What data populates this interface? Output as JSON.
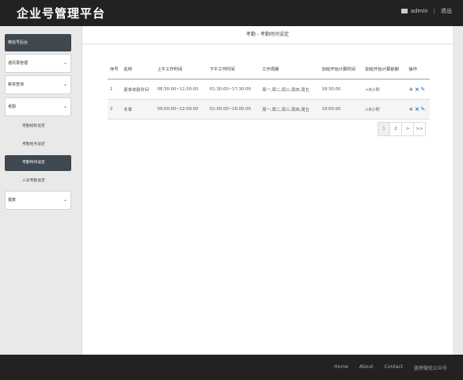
{
  "header": {
    "brand": "企业号管理平台",
    "username": "admin",
    "logout": "退出"
  },
  "sidebar": {
    "title": "微信号后台",
    "groups": [
      {
        "label": "通讯录管理"
      },
      {
        "label": "薪资查询"
      },
      {
        "label": "考勤"
      }
    ],
    "sub_items": [
      {
        "label": "考勤规则设定"
      },
      {
        "label": "考勤地点设定"
      },
      {
        "label": "考勤时间设定"
      },
      {
        "label": "人员考勤设定"
      }
    ],
    "last_group": {
      "label": "报表"
    }
  },
  "main": {
    "title": "考勤 - 考勤时间设定",
    "columns": [
      "序号",
      "名称",
      "上午工作时间",
      "下午工作时间",
      "工作周期",
      "加班开始计算时间",
      "加班开始计算前期",
      "操作"
    ],
    "rows": [
      [
        "1",
        "夏季考勤时间",
        "08:30:00~11:50:00",
        "01:30:00~17:30:00",
        "周一,周二,周三,周四,周五",
        "18:30:00",
        ">8小时"
      ],
      [
        "2",
        "冬季",
        "09:00:00~12:00:00",
        "01:00:00~16:00:00",
        "周一,周二,周三,周四,周五",
        "19:00:00",
        ">8小时"
      ]
    ],
    "actions": {
      "add": "+",
      "delete": "×",
      "edit": "✎"
    },
    "pagination": [
      "1",
      "2",
      ">",
      ">>"
    ]
  },
  "footer": {
    "links": [
      "Home",
      "About",
      "Contact",
      "蓝桥微信公众号"
    ]
  }
}
